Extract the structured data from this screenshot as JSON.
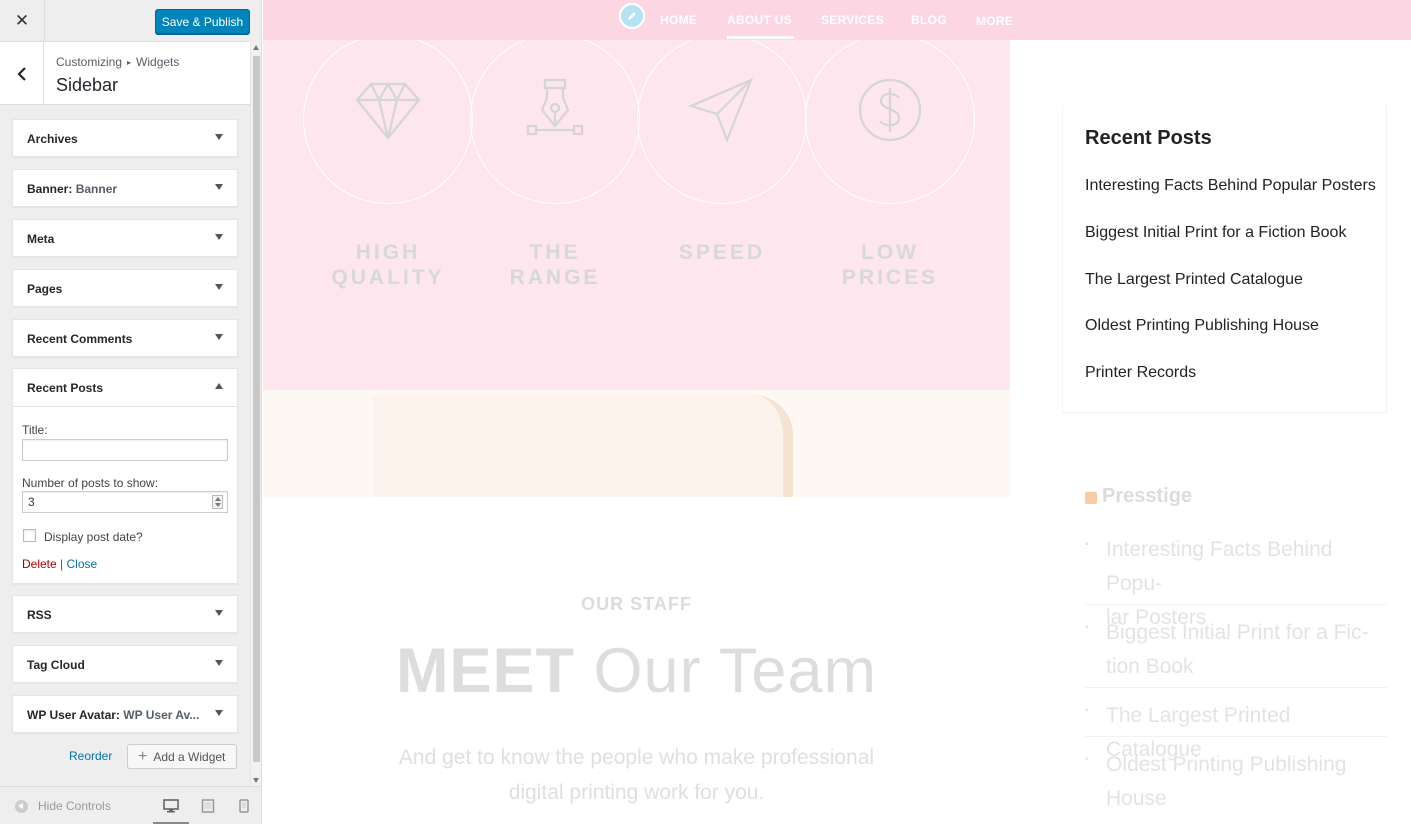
{
  "customizer": {
    "close_label": "✕",
    "save_label": "Save & Publish",
    "breadcrumb": {
      "root": "Customizing",
      "sep": "▸",
      "leaf": "Widgets"
    },
    "section": "Sidebar",
    "widgets": [
      {
        "title": "Archives",
        "sub": ""
      },
      {
        "title": "Banner:",
        "sub": "Banner"
      },
      {
        "title": "Meta",
        "sub": ""
      },
      {
        "title": "Pages",
        "sub": ""
      },
      {
        "title": "Recent Comments",
        "sub": ""
      },
      {
        "title": "Recent Posts",
        "sub": ""
      },
      {
        "title": "RSS",
        "sub": ""
      },
      {
        "title": "Tag Cloud",
        "sub": ""
      },
      {
        "title": "WP User Avatar:",
        "sub": "WP User Av..."
      }
    ],
    "recent_posts_form": {
      "title_label": "Title:",
      "title_value": "",
      "count_label": "Number of posts to show:",
      "count_value": "3",
      "date_label": "Display post date?",
      "date_checked": false,
      "delete": "Delete",
      "sep": "|",
      "close": "Close"
    },
    "reorder": "Reorder",
    "add_widget": "Add a Widget",
    "hide_controls": "Hide Controls"
  },
  "preview": {
    "nav": [
      "HOME",
      "ABOUT US",
      "SERVICES",
      "BLOG",
      "MORE"
    ],
    "nav_active": "ABOUT US",
    "features": [
      {
        "line1": "HIGH",
        "line2": "QUALITY",
        "icon": "diamond-icon"
      },
      {
        "line1": "THE",
        "line2": "RANGE",
        "icon": "pen-nib-icon"
      },
      {
        "line1": "SPEED",
        "line2": "",
        "icon": "paper-plane-icon"
      },
      {
        "line1": "LOW",
        "line2": "PRICES",
        "icon": "dollar-icon"
      }
    ],
    "staff": {
      "kicker": "OUR STAFF",
      "title_bold": "MEET",
      "title_rest": "Our Team",
      "desc": "And get to know the people who make professional digital printing work for you."
    },
    "recent_posts": {
      "title": "Recent Posts",
      "items": [
        "Interesting Facts Behind Popular Posters",
        "Biggest Initial Print for a Fiction Book",
        "The Largest Printed Catalogue",
        "Oldest Printing Publishing House",
        "Printer Records"
      ]
    },
    "rss": {
      "title": "Presstige",
      "items": [
        {
          "l1": "Interesting Facts Behind Popu-",
          "l2": "lar Posters"
        },
        {
          "l1": "Biggest Initial Print for a Fic-",
          "l2": "tion Book"
        },
        {
          "l1": "The Largest Printed Catalogue",
          "l2": ""
        },
        {
          "l1": "Oldest Printing Publishing",
          "l2": "House"
        }
      ]
    }
  }
}
